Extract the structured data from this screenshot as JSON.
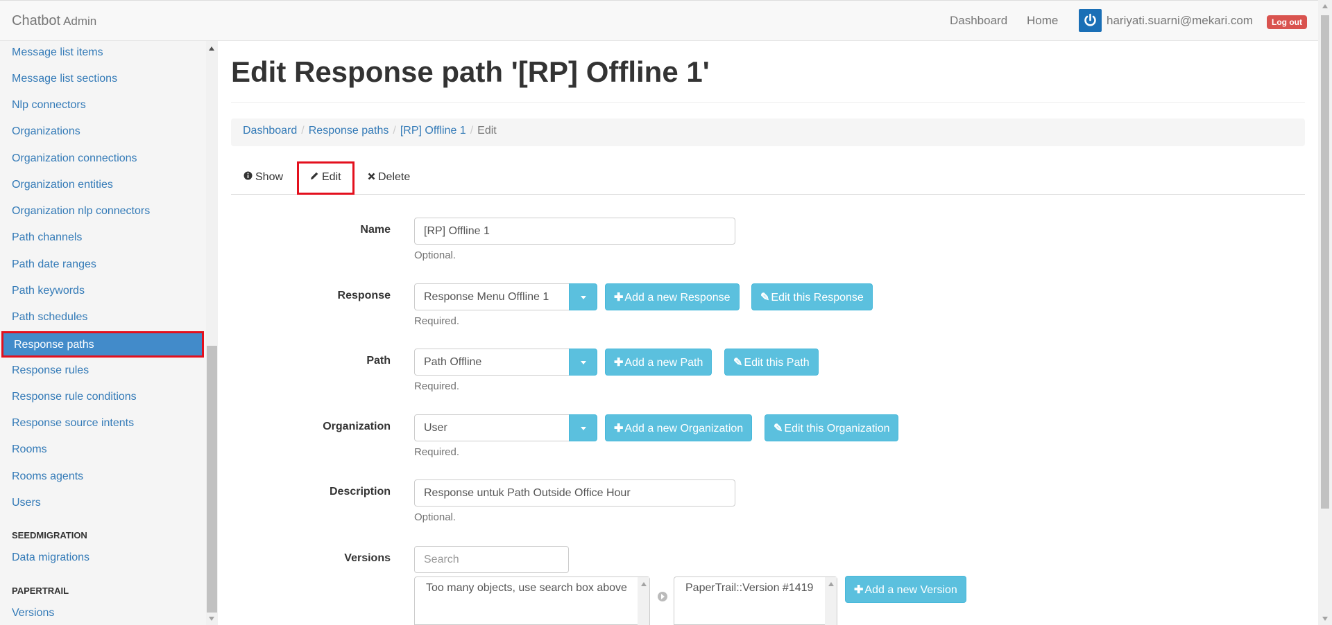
{
  "navbar": {
    "brand": "Chatbot",
    "brand_small": "Admin",
    "links": [
      "Dashboard",
      "Home"
    ],
    "user_email": "hariyati.suarni@mekari.com",
    "logout_label": "Log out"
  },
  "sidebar": {
    "items": [
      "Message list items",
      "Message list sections",
      "Nlp connectors",
      "Organizations",
      "Organization connections",
      "Organization entities",
      "Organization nlp connectors",
      "Path channels",
      "Path date ranges",
      "Path keywords",
      "Path schedules",
      "Response paths",
      "Response rules",
      "Response rule conditions",
      "Response source intents",
      "Rooms",
      "Rooms agents",
      "Users"
    ],
    "active_item": "Response paths",
    "section_seed": "SEEDMIGRATION",
    "seed_items": [
      "Data migrations"
    ],
    "section_papertrail": "PAPERTRAIL",
    "papertrail_items": [
      "Versions"
    ]
  },
  "page": {
    "title": "Edit Response path '[RP] Offline 1'"
  },
  "breadcrumb": [
    "Dashboard",
    "Response paths",
    "[RP] Offline 1",
    "Edit"
  ],
  "tabs": {
    "show": "Show",
    "edit": "Edit",
    "delete": "Delete"
  },
  "form": {
    "name": {
      "label": "Name",
      "value": "[RP] Offline 1",
      "help": "Optional."
    },
    "response": {
      "label": "Response",
      "value": "Response Menu Offline 1",
      "help": "Required.",
      "add": "Add a new Response",
      "edit": "Edit this Response"
    },
    "path": {
      "label": "Path",
      "value": "Path Offline",
      "help": "Required.",
      "add": "Add a new Path",
      "edit": "Edit this Path"
    },
    "organization": {
      "label": "Organization",
      "value": "User",
      "help": "Required.",
      "add": "Add a new Organization",
      "edit": "Edit this Organization"
    },
    "description": {
      "label": "Description",
      "value": "Response untuk Path Outside Office Hour",
      "help": "Optional."
    },
    "versions": {
      "label": "Versions",
      "search_placeholder": "Search",
      "available_text": "Too many objects, use search box above",
      "selected": [
        "PaperTrail::Version #1419"
      ],
      "add": "Add a new Version"
    }
  },
  "colors": {
    "link": "#337ab7",
    "active_bg": "#428bca",
    "info_btn": "#5bc0de",
    "danger": "#d9534f",
    "highlight": "#e3101d"
  },
  "icons": {
    "show": "info-circle-icon",
    "edit": "pencil-icon",
    "delete": "times-icon",
    "plus": "plus-icon",
    "avatar": "power-icon"
  }
}
